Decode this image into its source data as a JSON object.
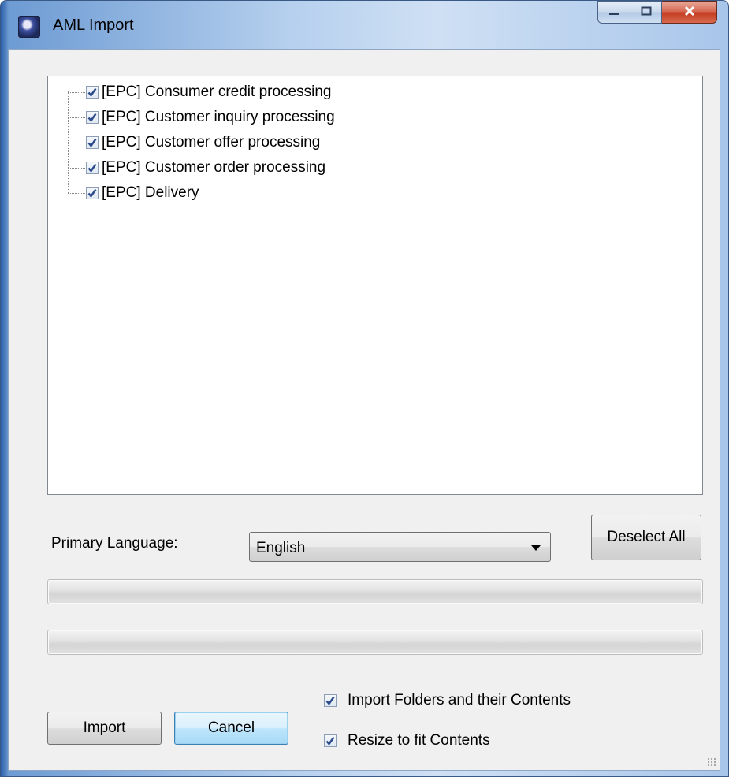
{
  "window": {
    "title": "AML Import",
    "icon": "app-icon",
    "controls": {
      "minimize": "minimize-icon",
      "maximize": "maximize-icon",
      "close": "close-icon"
    }
  },
  "tree": {
    "items": [
      {
        "label": "[EPC] Consumer credit processing",
        "checked": true
      },
      {
        "label": "[EPC] Customer inquiry processing",
        "checked": true
      },
      {
        "label": "[EPC] Customer offer processing",
        "checked": true
      },
      {
        "label": "[EPC] Customer order processing",
        "checked": true
      },
      {
        "label": "[EPC] Delivery",
        "checked": true
      }
    ]
  },
  "language": {
    "label": "Primary Language:",
    "selected": "English"
  },
  "buttons": {
    "deselect_all": "Deselect All",
    "import": "Import",
    "cancel": "Cancel"
  },
  "progress": {
    "primary": 0,
    "secondary": 0
  },
  "options": {
    "import_folders": {
      "label": "Import Folders and their Contents",
      "checked": true
    },
    "resize_to_fit": {
      "label": "Resize to fit Contents",
      "checked": true
    }
  },
  "colors": {
    "accent": "#3c7fb1",
    "checkmark": "#2a4a8c"
  }
}
